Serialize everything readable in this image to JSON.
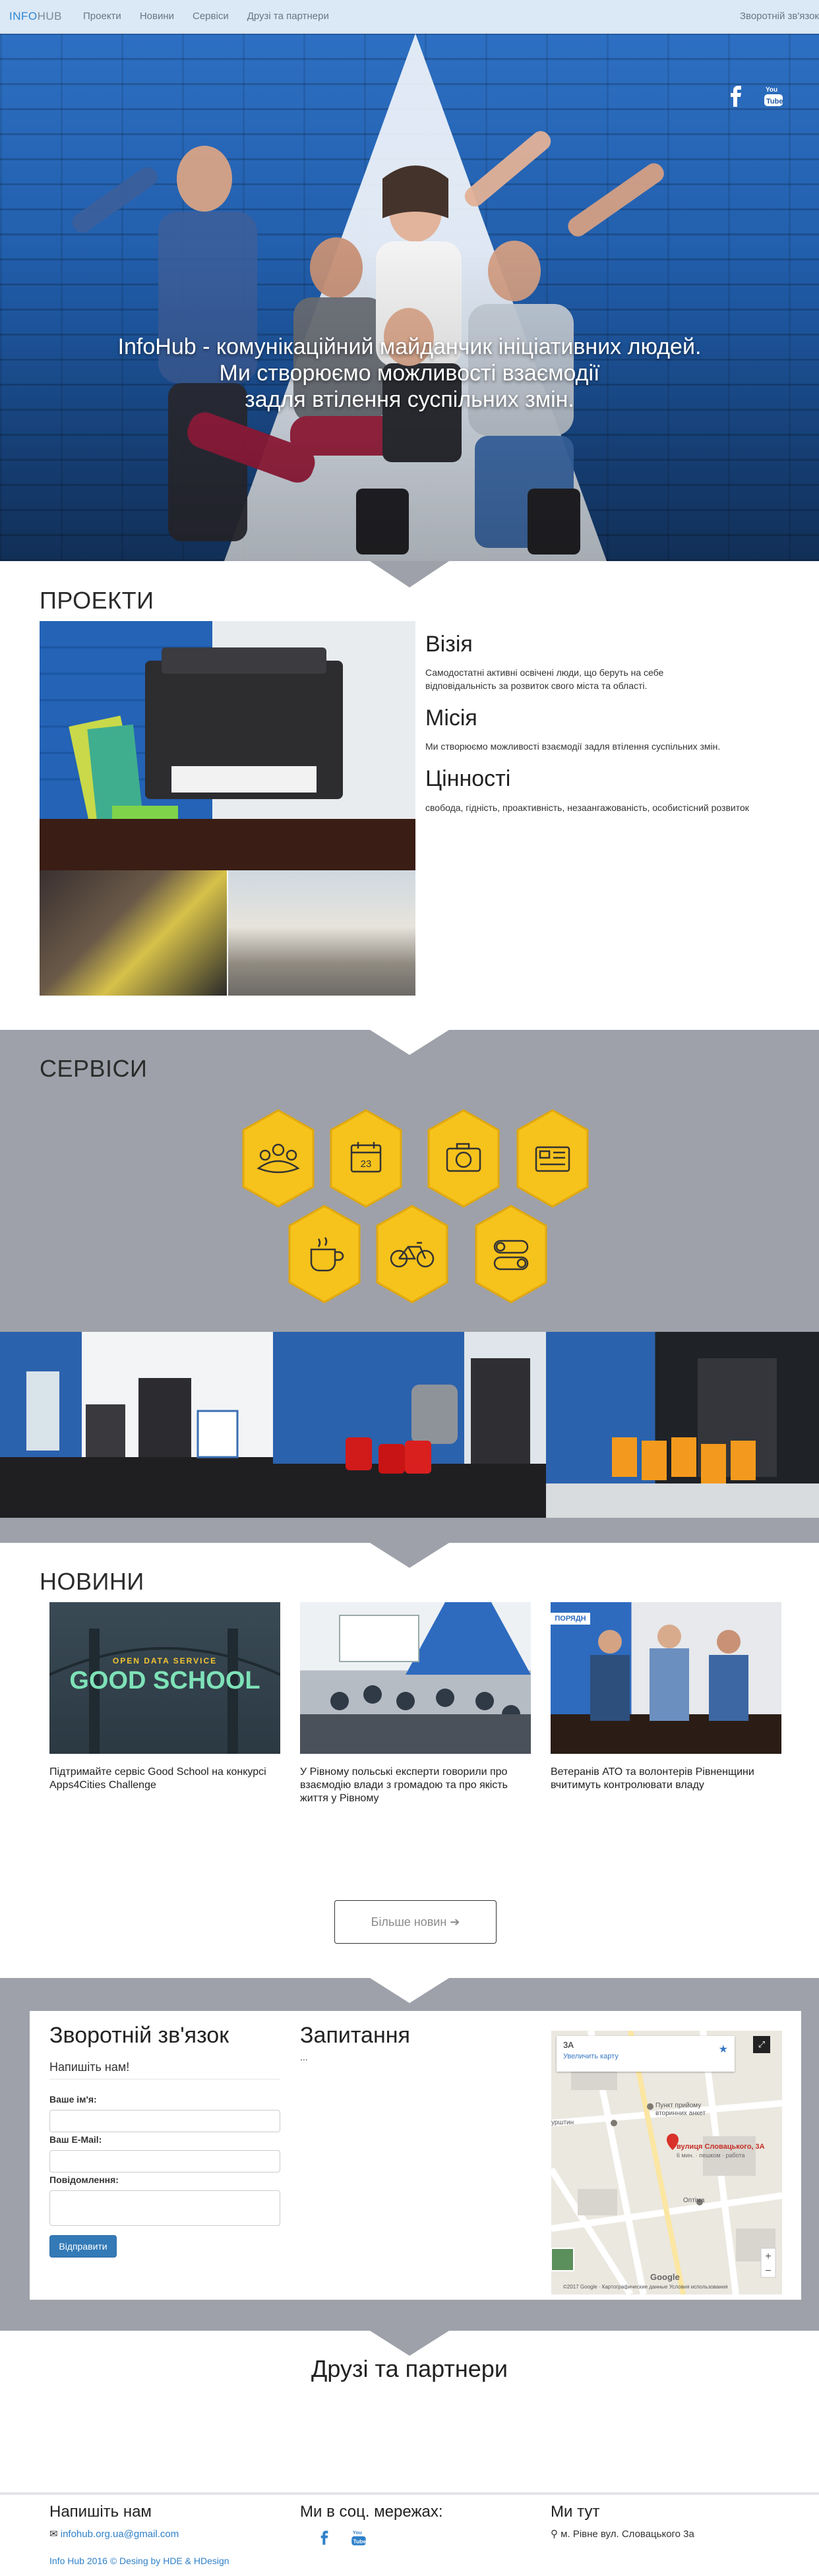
{
  "nav": {
    "brand_part1": "INFO",
    "brand_part2": "HUB",
    "links": [
      "Проекти",
      "Новини",
      "Сервіси",
      "Друзі та партнери"
    ],
    "right_link": "Зворотній зв'язок"
  },
  "hero": {
    "line1": "InfoHub - комунікаційний майданчик ініціативних людей.",
    "line2": "Ми створюємо можливості взаємодії",
    "line3": "задля втілення суспільних змін.",
    "social_icons": [
      "facebook-icon",
      "youtube-icon"
    ]
  },
  "projects": {
    "title": "ПРОЕКТИ",
    "vision_title": "Візія",
    "vision_text": "Самодостатні активні освічені люди, що беруть на себе відповідальність за розвиток свого міста та області.",
    "mission_title": "Місія",
    "mission_text": "Ми створюємо можливості взаємодії задля втілення суспільних змін.",
    "values_title": "Цінності",
    "values_text": "свобода, гідність, проактивність, незаангажованість, особистісний розвиток"
  },
  "services": {
    "title": "СЕРВІСИ",
    "icons": [
      "people-icon",
      "calendar-icon",
      "camera-icon",
      "id-card-icon",
      "coffee-cup-icon",
      "bicycle-icon",
      "toggle-switch-icon"
    ],
    "calendar_number": "23",
    "accent": "#f6c21c"
  },
  "news": {
    "title": "НОВИНИ",
    "items": [
      {
        "title": "Підтримайте сервіс Good School на конкурсі Apps4Cities Challenge",
        "img_top": "OPEN DATA SERVICE",
        "img_main": "GOOD SCHOOL"
      },
      {
        "title": "У Рівному польські експерти говорили про взаємодію влади з громадою та про якість життя у Рівному"
      },
      {
        "title": "Ветеранів АТО та волонтерів Рівненщини вчитимуть контролювати владу",
        "img_sign": "ПОРЯДН"
      }
    ],
    "more_button": "Більше новин ➔"
  },
  "contact": {
    "title": "Зворотній зв'язок",
    "subtitle": "Напишіть нам!",
    "name_label": "Ваше ім'я:",
    "email_label": "Ваш E-Mail:",
    "message_label": "Повідомлення:",
    "submit": "Відправити",
    "questions_title": "Запитання",
    "questions_text": "...",
    "map": {
      "place": "3А",
      "enlarge": "Увеличить карту",
      "street_label": "вулиця Словацького, 3А",
      "street_sub": "6 мин. · пешком · работа",
      "poi1": "Пункт прийому вторинних анкет",
      "poi2": "Оптіма",
      "street1": "урштин",
      "google": "Google",
      "copyright": "©2017 Google · Картографические данные   Условия использования"
    }
  },
  "partners": {
    "title": "Друзі та партнери"
  },
  "footer": {
    "write_title": "Напишіть нам",
    "email": "infohub.org.ua@gmail.com",
    "social_title": "Ми в соц. мережах:",
    "here_title": "Ми тут",
    "address": "м. Рівне вул. Словацького 3а",
    "copyright_prefix": "Info Hub 2016 © Desing by ",
    "hde": "HDE",
    "amp": " & ",
    "hdesign": "HDesign"
  }
}
